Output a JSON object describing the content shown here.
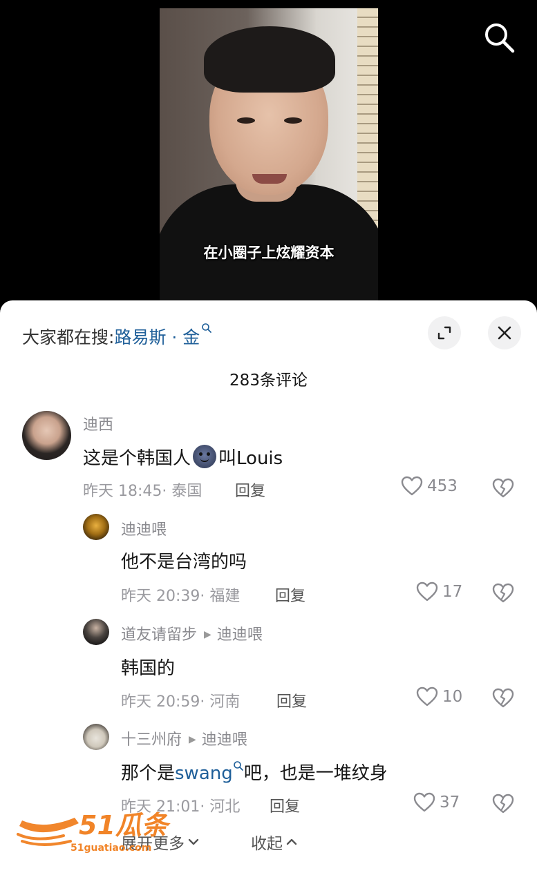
{
  "video": {
    "subtitle": "在小圈子上炫耀资本",
    "search_icon": "search-icon"
  },
  "sheet": {
    "hot_search_prefix": "大家都在搜:",
    "hot_search_keyword": "路易斯 · 金",
    "comment_count_title": "283条评论",
    "expand_icon": "expand-icon",
    "close_icon": "close-icon"
  },
  "comments": [
    {
      "user": "迪西",
      "reply_to": "",
      "text_before": "这是个韩国人",
      "emoji": "sticker-emoji",
      "text_after": "叫Louis",
      "time": "昨天 18:45",
      "location": "· 泰国",
      "reply_label": "回复",
      "likes": "453"
    },
    {
      "user": "迪迪喂",
      "reply_to": "",
      "text": "他不是台湾的吗",
      "time": "昨天 20:39",
      "location": "· 福建",
      "reply_label": "回复",
      "likes": "17"
    },
    {
      "user": "道友请留步",
      "reply_to": "迪迪喂",
      "text": "韩国的",
      "time": "昨天 20:59",
      "location": "· 河南",
      "reply_label": "回复",
      "likes": "10"
    },
    {
      "user": "十三州府",
      "reply_to": "迪迪喂",
      "text_before": "那个是",
      "link": "swang",
      "text_after": "吧，也是一堆纹身",
      "time": "昨天 21:01",
      "location": "· 河北",
      "reply_label": "回复",
      "likes": "37"
    }
  ],
  "footer": {
    "expand_more": "展开更多",
    "collapse": "收起"
  },
  "watermark": {
    "brand": "51瓜条",
    "url": "51guatiao.com"
  },
  "colors": {
    "link": "#1f5f99",
    "muted": "#8a8a8f",
    "watermark": "#f07a16"
  }
}
